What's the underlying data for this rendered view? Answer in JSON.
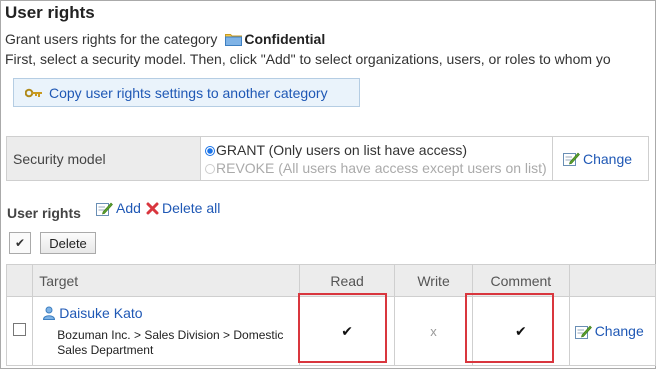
{
  "page": {
    "title": "User rights",
    "grant_prefix": "Grant users rights for the category",
    "category_name": "Confidential",
    "instruction": "First, select a security model. Then, click \"Add\" to select organizations, users, or roles to whom yo"
  },
  "copy_button": {
    "label": "Copy user rights settings to another category"
  },
  "security_model": {
    "label": "Security model",
    "options": [
      {
        "label": "GRANT (Only users on list have access)",
        "selected": true
      },
      {
        "label": "REVOKE (All users have access except users on list)",
        "selected": false
      }
    ],
    "change_label": "Change"
  },
  "user_rights": {
    "heading": "User rights",
    "add_label": "Add",
    "delete_all_label": "Delete all",
    "select_all_mark": "✔",
    "delete_label": "Delete",
    "columns": {
      "target": "Target",
      "read": "Read",
      "write": "Write",
      "comment": "Comment"
    },
    "rows": [
      {
        "user_name": "Daisuke Kato",
        "organization": "Bozuman Inc. > Sales Division > Domestic Sales Department",
        "read": "✔",
        "write": "x",
        "comment": "✔",
        "change_label": "Change"
      }
    ]
  },
  "colors": {
    "link": "#1f58b5",
    "highlight": "#d9363e",
    "header_bg": "#ececec"
  }
}
